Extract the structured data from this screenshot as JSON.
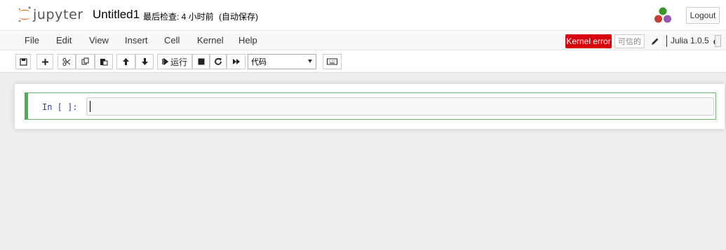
{
  "header": {
    "logo_text": "jupyter",
    "notebook_name": "Untitled1",
    "checkpoint": "最后检查: 4 小时前",
    "autosave": "(自动保存)",
    "logout_label": "Logout",
    "kernel_logo_icon": "julia-logo-icon"
  },
  "menubar": {
    "items": [
      "File",
      "Edit",
      "View",
      "Insert",
      "Cell",
      "Kernel",
      "Help"
    ],
    "kernel_error": "Kernel error",
    "trusted": "可信的",
    "kernel_name": "Julia 1.0.5",
    "error_color": "#d9000e"
  },
  "toolbar": {
    "run_label": "运行",
    "cell_type": "代码",
    "icons": [
      "save-icon",
      "plus-icon",
      "cut-icon",
      "copy-icon",
      "paste-icon",
      "arrow-up-icon",
      "arrow-down-icon",
      "run-icon",
      "stop-icon",
      "restart-icon",
      "fast-forward-icon",
      "keyboard-icon"
    ]
  },
  "cell": {
    "prompt": "In [ ]:",
    "source": ""
  }
}
